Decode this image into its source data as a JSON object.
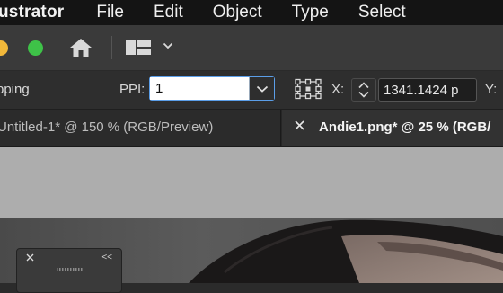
{
  "menubar": {
    "app_name": "llustrator",
    "items": [
      "File",
      "Edit",
      "Object",
      "Type",
      "Select"
    ]
  },
  "controlbar": {
    "left_label": "pping",
    "ppi_label": "PPI:",
    "ppi_value": "1",
    "x_label": "X:",
    "x_value": "1341.1424 p",
    "y_label": "Y:"
  },
  "tabs": {
    "inactive_label": "Untitled-1* @ 150 % (RGB/Preview)",
    "active_label": "Andie1.png* @ 25 % (RGB/"
  },
  "panel": {
    "collapse_label": "<<"
  },
  "colors": {
    "accent": "#5b9ee8",
    "traffic_yellow": "#f2b83a",
    "traffic_green": "#3ec248"
  }
}
